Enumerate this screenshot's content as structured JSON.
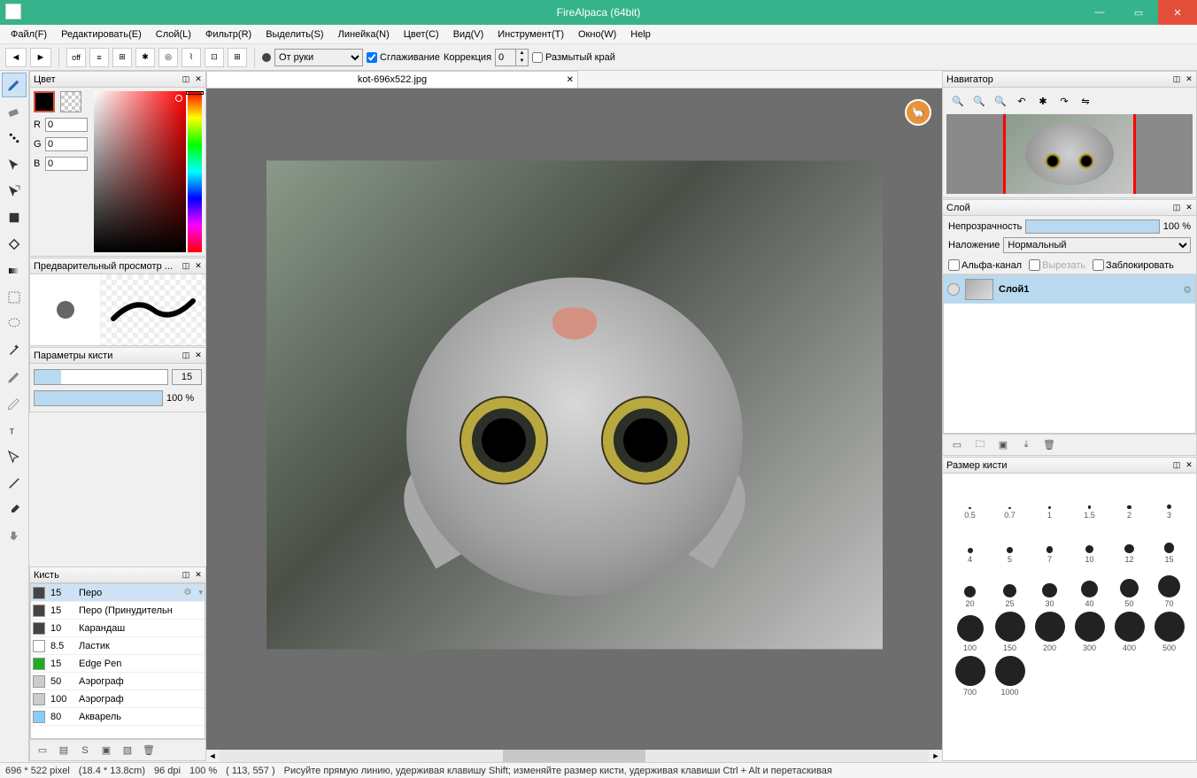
{
  "title": "FireAlpaca (64bit)",
  "menu": [
    "Файл(F)",
    "Редактировать(E)",
    "Слой(L)",
    "Фильтр(R)",
    "Выделить(S)",
    "Линейка(N)",
    "Цвет(C)",
    "Вид(V)",
    "Инструмент(T)",
    "Окно(W)",
    "Help"
  ],
  "toolbar": {
    "off_label": "off",
    "mode_select": "От руки",
    "smoothing_label": "Сглаживание",
    "correction_label": "Коррекция",
    "correction_value": "0",
    "blur_edge_label": "Размытый край"
  },
  "panels": {
    "color": {
      "title": "Цвет",
      "r": "0",
      "g": "0",
      "b": "0"
    },
    "preview": {
      "title": "Предварительный просмотр ..."
    },
    "brush_params": {
      "title": "Параметры кисти",
      "size": "15",
      "opacity": "100 %"
    },
    "brush": {
      "title": "Кисть",
      "items": [
        {
          "color": "#444",
          "size": "15",
          "name": "Перо",
          "active": true
        },
        {
          "color": "#444",
          "size": "15",
          "name": "Перо (Принудительн"
        },
        {
          "color": "#444",
          "size": "10",
          "name": "Карандаш"
        },
        {
          "color": "#fff",
          "size": "8.5",
          "name": "Ластик"
        },
        {
          "color": "#2a2",
          "size": "15",
          "name": "Edge Pen"
        },
        {
          "color": "#ccc",
          "size": "50",
          "name": "Аэрограф"
        },
        {
          "color": "#ccc",
          "size": "100",
          "name": "Аэрограф"
        },
        {
          "color": "#8cf",
          "size": "80",
          "name": "Акварель"
        }
      ]
    },
    "navigator": {
      "title": "Навигатор"
    },
    "layer": {
      "title": "Слой",
      "opacity_label": "Непрозрачность",
      "opacity_value": "100 %",
      "blend_label": "Наложение",
      "blend_value": "Нормальный",
      "alpha_label": "Альфа-канал",
      "clip_label": "Вырезать",
      "lock_label": "Заблокировать",
      "layer1": "Слой1"
    },
    "brush_size": {
      "title": "Размер кисти",
      "sizes": [
        0.5,
        0.7,
        1,
        1.5,
        2,
        3,
        4,
        5,
        7,
        10,
        12,
        15,
        20,
        25,
        30,
        40,
        50,
        70,
        100,
        150,
        200,
        300,
        400,
        500,
        700,
        1000
      ]
    }
  },
  "tab": {
    "filename": "kot-696x522.jpg"
  },
  "status": {
    "dims": "696 * 522 pixel",
    "phys": "(18.4 * 13.8cm)",
    "dpi": "96 dpi",
    "zoom": "100 %",
    "coords": "( 113, 557 )",
    "hint": "Рисуйте прямую линию, удерживая клавишу Shift; изменяйте размер кисти, удерживая клавиши Ctrl + Alt и перетаскивая"
  }
}
